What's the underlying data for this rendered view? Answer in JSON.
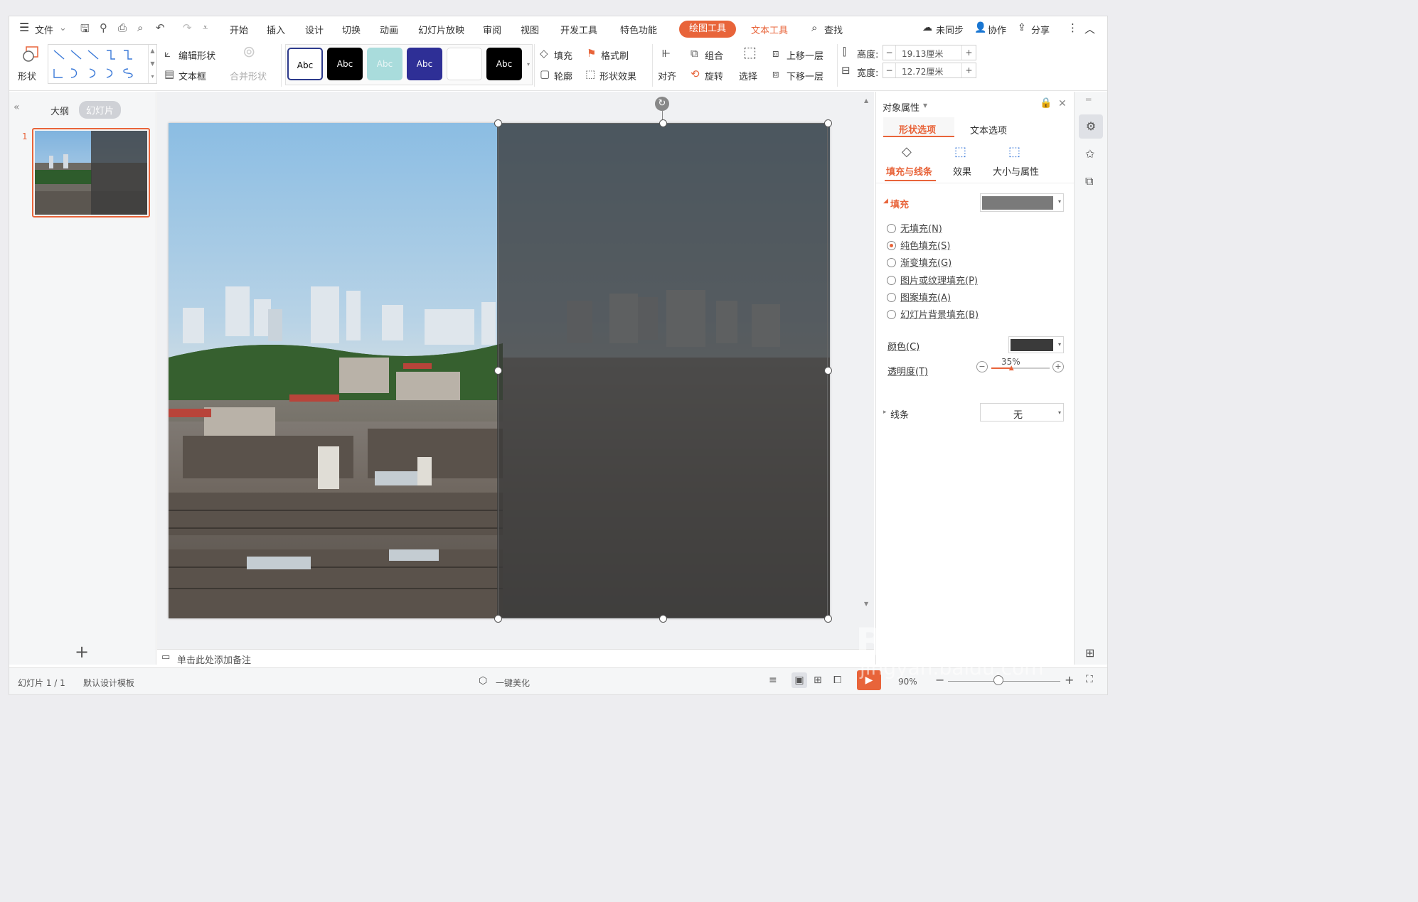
{
  "menubar": {
    "file_label": "文件",
    "tabs": [
      "开始",
      "插入",
      "设计",
      "切换",
      "动画",
      "幻灯片放映",
      "审阅",
      "视图",
      "开发工具",
      "特色功能"
    ],
    "active_tool": "绘图工具",
    "text_tool": "文本工具",
    "search": "查找",
    "sync": "未同步",
    "collab": "协作",
    "share": "分享"
  },
  "toolbar": {
    "shape": "形状",
    "edit_shape": "编辑形状",
    "text_box": "文本框",
    "merge_shape": "合并形状",
    "style_samples": [
      "Abc",
      "Abc",
      "Abc",
      "Abc",
      "",
      "Abc"
    ],
    "fill": "填充",
    "format_painter": "格式刷",
    "outline": "轮廓",
    "shape_effect": "形状效果",
    "align": "对齐",
    "group": "组合",
    "rotate": "旋转",
    "select": "选择",
    "bring_forward": "上移一层",
    "send_backward": "下移一层",
    "height_label": "高度:",
    "height_value": "19.13厘米",
    "width_label": "宽度:",
    "width_value": "12.72厘米"
  },
  "left_panel": {
    "tab_outline": "大纲",
    "tab_slides": "幻灯片",
    "slide_number": "1"
  },
  "notes_placeholder": "单击此处添加备注",
  "right_panel": {
    "title": "对象属性",
    "tab_shape": "形状选项",
    "tab_text": "文本选项",
    "sub_fill_line": "填充与线条",
    "sub_effect": "效果",
    "sub_size": "大小与属性",
    "fill_section": "填充",
    "fill_options": [
      "无填充(N)",
      "纯色填充(S)",
      "渐变填充(G)",
      "图片或纹理填充(P)",
      "图案填充(A)",
      "幻灯片背景填充(B)"
    ],
    "fill_selected_index": 1,
    "color_label": "颜色(C)",
    "transparency_label": "透明度(T)",
    "transparency_value": "35%",
    "line_section": "线条",
    "line_value": "无",
    "fill_swatch_color": "#7a7a7a",
    "color_swatch_color": "#3a3a3a"
  },
  "statusbar": {
    "slide_info": "幻灯片 1 / 1",
    "template": "默认设计模板",
    "beautify": "一键美化",
    "zoom": "90%"
  },
  "watermark": {
    "brand": "Bai du 经验",
    "url": "jingyan.baidu.com"
  },
  "colors": {
    "accent": "#e8643a"
  }
}
